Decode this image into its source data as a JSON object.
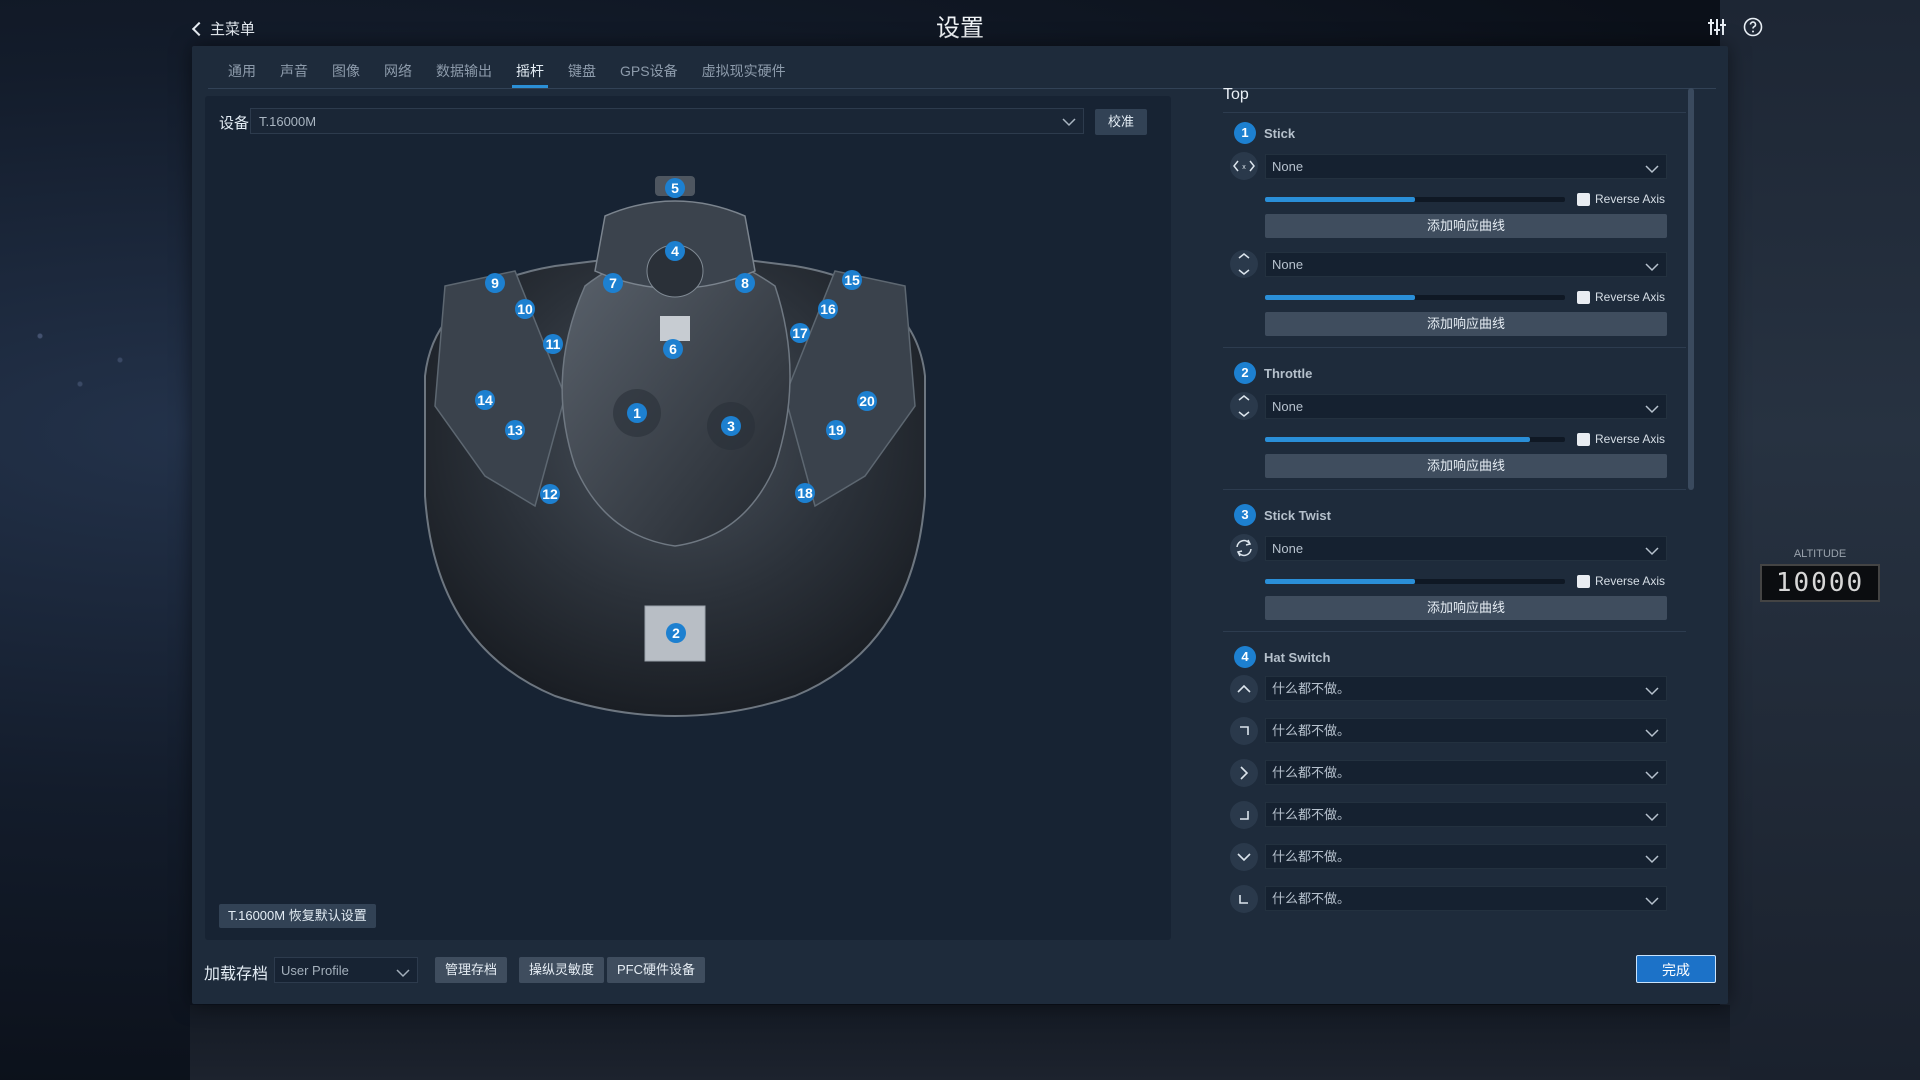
{
  "header": {
    "back_label": "主菜单",
    "title": "设置"
  },
  "tabs": [
    {
      "label": "通用"
    },
    {
      "label": "声音"
    },
    {
      "label": "图像"
    },
    {
      "label": "网络"
    },
    {
      "label": "数据输出"
    },
    {
      "label": "摇杆",
      "active": true
    },
    {
      "label": "键盘"
    },
    {
      "label": "GPS设备"
    },
    {
      "label": "虚拟现实硬件"
    }
  ],
  "device": {
    "label": "设备",
    "value": "T.16000M",
    "calibrate_label": "校准",
    "restore_label": "T.16000M 恢复默认设置"
  },
  "joystick_buttons": [
    "1",
    "2",
    "3",
    "4",
    "5",
    "6",
    "7",
    "8",
    "9",
    "10",
    "11",
    "12",
    "13",
    "14",
    "15",
    "16",
    "17",
    "18",
    "19",
    "20"
  ],
  "right_panel": {
    "section_title": "Top",
    "groups": [
      {
        "num": "1",
        "name": "Stick",
        "axes": [
          {
            "icon": "horizontal-axis-icon",
            "value": "None",
            "slider": 0.5,
            "reverse_label": "Reverse Axis",
            "curve_label": "添加响应曲线"
          },
          {
            "icon": "vertical-axis-icon",
            "value": "None",
            "slider": 0.5,
            "reverse_label": "Reverse Axis",
            "curve_label": "添加响应曲线"
          }
        ]
      },
      {
        "num": "2",
        "name": "Throttle",
        "axes": [
          {
            "icon": "vertical-axis-icon",
            "value": "None",
            "slider": 0.88,
            "reverse_label": "Reverse Axis",
            "curve_label": "添加响应曲线"
          }
        ]
      },
      {
        "num": "3",
        "name": "Stick Twist",
        "axes": [
          {
            "icon": "twist-axis-icon",
            "value": "None",
            "slider": 0.5,
            "reverse_label": "Reverse Axis",
            "curve_label": "添加响应曲线"
          }
        ]
      },
      {
        "num": "4",
        "name": "Hat Switch",
        "hats": [
          {
            "icon": "hat-up-icon",
            "value": "什么都不做。"
          },
          {
            "icon": "hat-up-right-icon",
            "value": "什么都不做。"
          },
          {
            "icon": "hat-right-icon",
            "value": "什么都不做。"
          },
          {
            "icon": "hat-down-right-icon",
            "value": "什么都不做。"
          },
          {
            "icon": "hat-down-icon",
            "value": "什么都不做。"
          },
          {
            "icon": "hat-down-left-icon",
            "value": "什么都不做。"
          }
        ]
      }
    ]
  },
  "bottom_bar": {
    "load_label": "加载存档",
    "profile_value": "User Profile",
    "manage_label": "管理存档",
    "sensitivity_label": "操纵灵敏度",
    "pfc_label": "PFC硬件设备",
    "done_label": "完成"
  },
  "background": {
    "altitude_label": "ALTITUDE",
    "altitude_value": "10000"
  }
}
